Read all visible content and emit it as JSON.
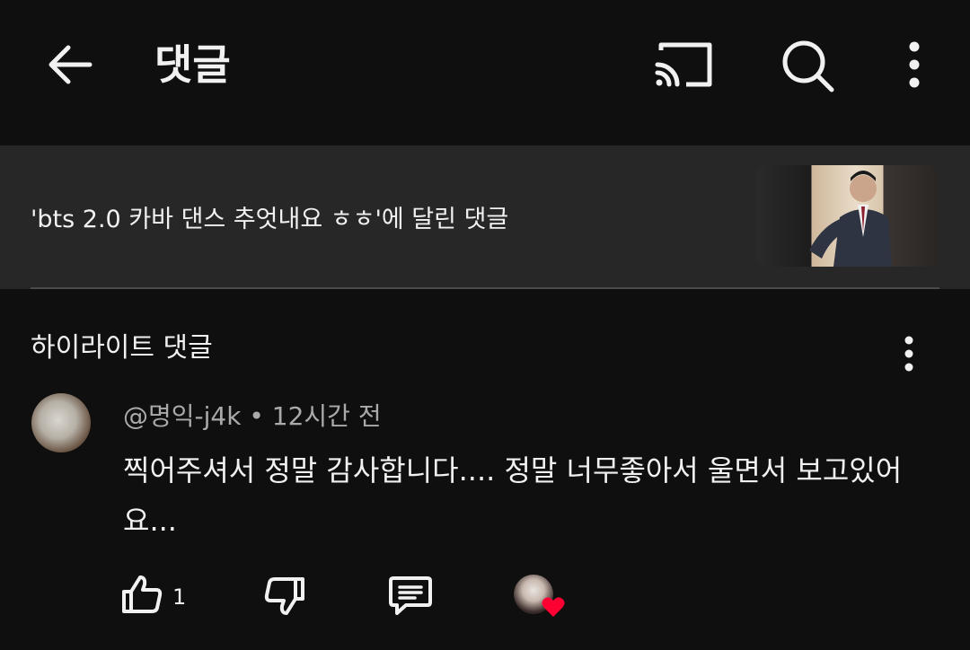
{
  "header": {
    "title": "댓글",
    "back_icon": "arrow-left-icon",
    "cast_icon": "cast-icon",
    "search_icon": "search-icon",
    "more_icon": "more-vertical-icon"
  },
  "video": {
    "caption": "'bts 2.0 카바 댄스 추엇내요 ㅎㅎ'에 달린 댓글"
  },
  "highlight": {
    "title": "하이라이트 댓글",
    "more_icon": "more-vertical-icon"
  },
  "comment": {
    "author": "@명익-j4k",
    "separator": "•",
    "time": "12시간 전",
    "text": "찍어주셔서 정말 감사합니다.... 정말 너무좋아서 울면서 보고있어요...",
    "like_count": "1"
  },
  "colors": {
    "background": "#0f0f0f",
    "card": "#272727",
    "heart": "#ff0033",
    "meta": "#aaaaaa"
  }
}
